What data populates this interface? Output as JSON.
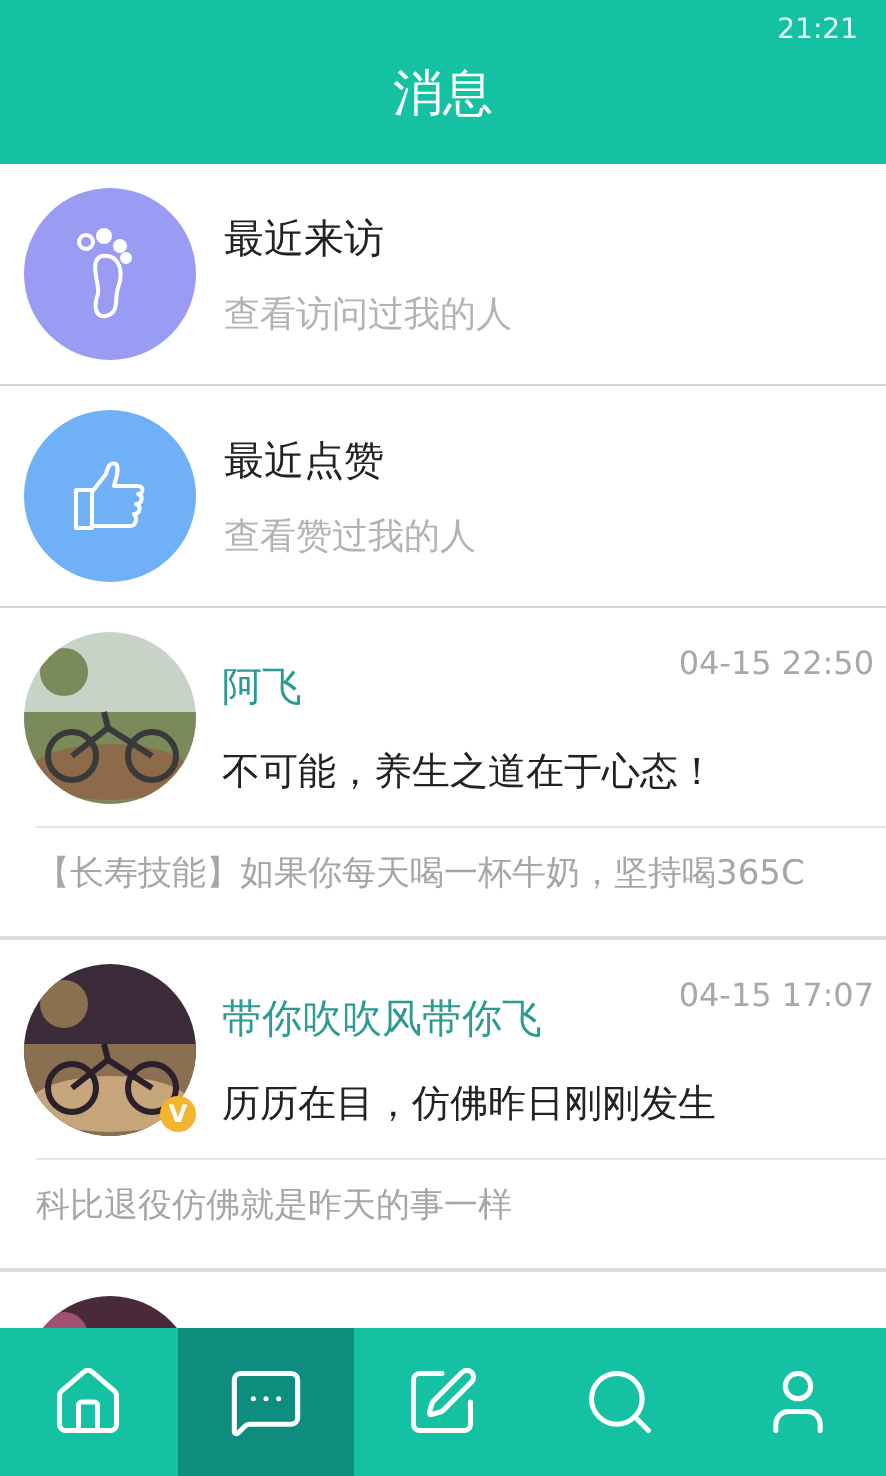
{
  "status_bar": {
    "time": "21:21"
  },
  "header": {
    "title": "消息"
  },
  "shortcuts": [
    {
      "kind": "footprint",
      "title": "最近来访",
      "subtitle": "查看访问过我的人",
      "color": "#9a9cf3"
    },
    {
      "kind": "thumb",
      "title": "最近点赞",
      "subtitle": "查看赞过我的人",
      "color": "#6fb0f7"
    }
  ],
  "messages": [
    {
      "avatar": {
        "kind": "picture"
      },
      "name": "阿飞",
      "time": "04-15 22:50",
      "text": "不可能，养生之道在于心态！",
      "preview": "【长寿技能】如果你每天喝一杯牛奶，坚持喝365C"
    },
    {
      "avatar": {
        "kind": "picture"
      },
      "badge": "V",
      "name": "带你吹吹风带你飞",
      "time": "04-15 17:07",
      "text": "历历在目，仿佛昨日刚刚发生",
      "preview": "科比退役仿佛就是昨天的事一样"
    },
    {
      "avatar": {
        "kind": "picture"
      }
    }
  ],
  "nav": [
    {
      "kind": "home",
      "selected": false
    },
    {
      "kind": "message",
      "selected": true
    },
    {
      "kind": "compose",
      "selected": false
    },
    {
      "kind": "search",
      "selected": false
    },
    {
      "kind": "profile",
      "selected": false
    }
  ]
}
